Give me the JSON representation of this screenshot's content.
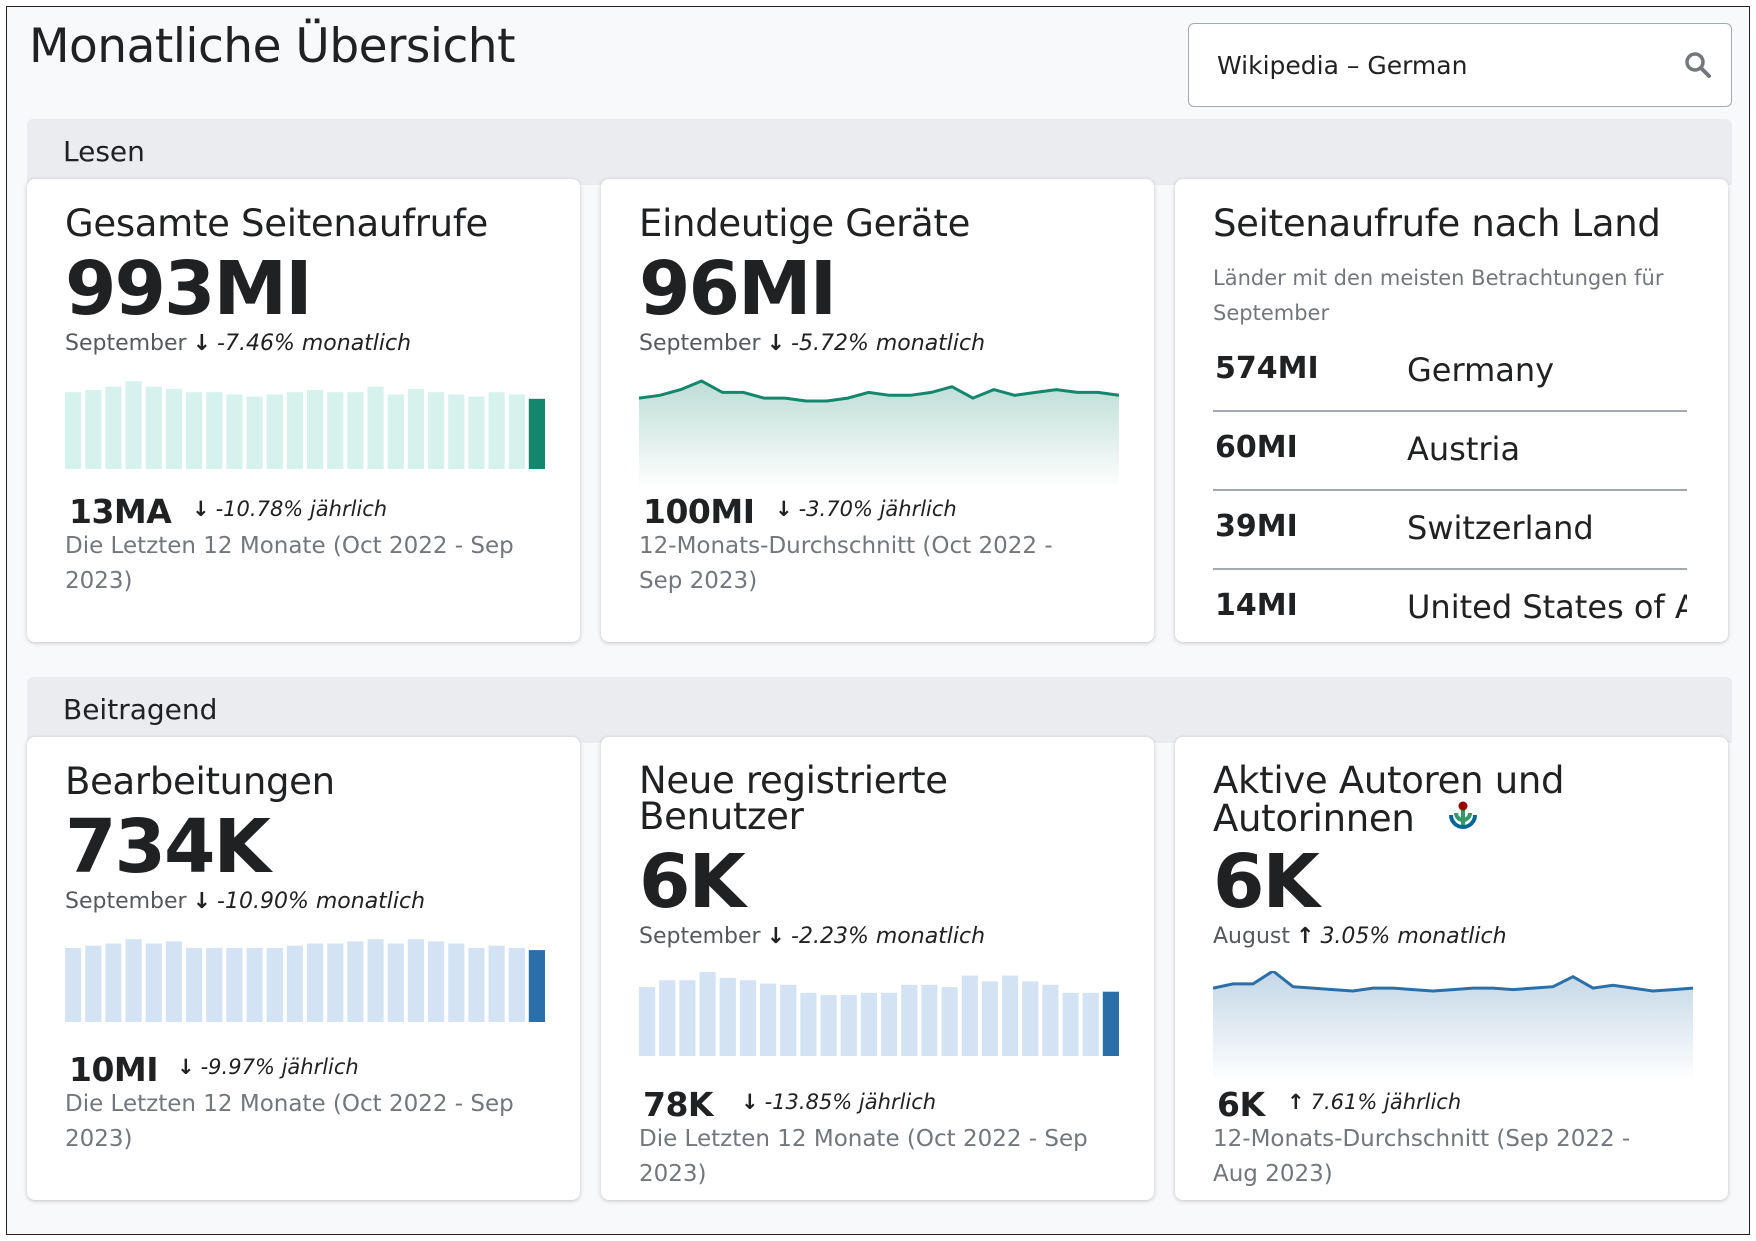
{
  "header": {
    "title": "Monatliche Übersicht",
    "search_value": "Wikipedia – German",
    "search_icon": "search-icon"
  },
  "sections": [
    {
      "label": "Lesen"
    },
    {
      "label": "Beitragend"
    }
  ],
  "cards": {
    "pageviews": {
      "title": "Gesamte Seitenaufrufe",
      "value": "993MI",
      "month": "September",
      "month_change": "-7.46% monatlich",
      "total": "13MA",
      "total_change": "-10.78% jährlich",
      "period": "Die Letzten 12 Monate (Oct 2022 - Sep 2023)",
      "accent": "#14866d",
      "light": "#d5f2ec"
    },
    "devices": {
      "title": "Eindeutige Geräte",
      "value": "96MI",
      "month": "September",
      "month_change": "-5.72% monatlich",
      "total": "100MI",
      "total_change": "-3.70% jährlich",
      "period": "12-Monats-Durchschnitt (Oct 2022 - Sep 2023)",
      "accent": "#14866d"
    },
    "country": {
      "title": "Seitenaufrufe nach Land",
      "subtitle": "Länder mit den meisten Betrachtungen für September",
      "rows": [
        {
          "value": "574MI",
          "country": "Germany"
        },
        {
          "value": "60MI",
          "country": "Austria"
        },
        {
          "value": "39MI",
          "country": "Switzerland"
        },
        {
          "value": "14MI",
          "country": "United States of America"
        }
      ]
    },
    "edits": {
      "title": "Bearbeitungen",
      "value": "734K",
      "month": "September",
      "month_change": "-10.90% monatlich",
      "total": "10MI",
      "total_change": "-9.97% jährlich",
      "period": "Die Letzten 12 Monate (Oct 2022 - Sep 2023)",
      "accent": "#2a6fa8",
      "light": "#d3e3f3"
    },
    "new_users": {
      "title_line1": "Neue registrierte",
      "title_line2": "Benutzer",
      "value": "6K",
      "month": "September",
      "month_change": "-2.23% monatlich",
      "total": "78K",
      "total_change": "-13.85% jährlich",
      "period": "Die Letzten 12 Monate (Oct 2022 - Sep 2023)",
      "accent": "#2a6fa8",
      "light": "#d3e3f3"
    },
    "active_editors": {
      "title_line1": "Aktive Autoren und",
      "title_line2": "Autorinnen",
      "value": "6K",
      "month": "August",
      "month_change": "3.05% monatlich",
      "total": "6K",
      "total_change": "7.61% jährlich",
      "period": "12-Monats-Durchschnitt (Sep 2022 - Aug 2023)",
      "accent": "#2a6fa8",
      "badge_icon": "wikimedia-logo-icon"
    }
  },
  "chart_data": [
    {
      "type": "bar",
      "name": "pageviews",
      "values": [
        70,
        72,
        75,
        80,
        75,
        73,
        70,
        70,
        68,
        66,
        68,
        70,
        72,
        70,
        70,
        75,
        68,
        73,
        70,
        68,
        66,
        70,
        68,
        64
      ]
    },
    {
      "type": "area",
      "name": "devices",
      "values": [
        95,
        96,
        98,
        101,
        97,
        97,
        95,
        95,
        94,
        94,
        95,
        97,
        96,
        96,
        97,
        99,
        95,
        98,
        96,
        97,
        98,
        97,
        97,
        96
      ]
    },
    {
      "type": "bar",
      "name": "edits",
      "values": [
        68,
        70,
        72,
        76,
        72,
        74,
        68,
        68,
        68,
        68,
        68,
        70,
        72,
        72,
        74,
        76,
        72,
        76,
        74,
        72,
        68,
        70,
        68,
        66
      ]
    },
    {
      "type": "bar",
      "name": "new_users",
      "values": [
        60,
        66,
        66,
        73,
        68,
        66,
        63,
        62,
        55,
        53,
        53,
        55,
        55,
        62,
        62,
        60,
        70,
        65,
        70,
        65,
        62,
        55,
        55,
        56
      ]
    },
    {
      "type": "area",
      "name": "active_editors",
      "values": [
        82,
        85,
        85,
        94,
        83,
        82,
        81,
        80,
        82,
        82,
        81,
        80,
        81,
        82,
        82,
        81,
        82,
        83,
        90,
        82,
        84,
        82,
        80,
        81,
        82
      ]
    }
  ]
}
